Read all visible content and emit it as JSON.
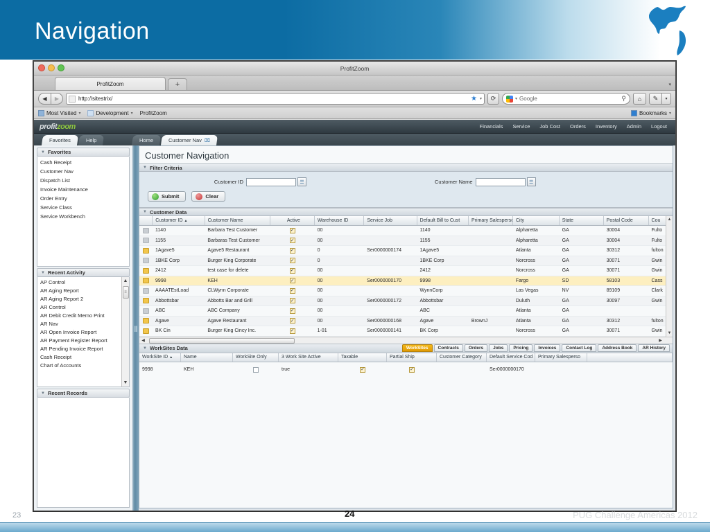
{
  "slide": {
    "title": "Navigation",
    "page_left": "23",
    "page_center": "24",
    "footer_right": "PUG Challenge Americas 2012"
  },
  "browser": {
    "window_title": "ProfitZoom",
    "tab_label": "ProfitZoom",
    "new_tab": "+",
    "back_icon": "◀",
    "forward_icon": "▶",
    "reload_icon": "⟳",
    "url": "http://sitestrix/",
    "star_icon": "★",
    "caret_icon": "▾",
    "search_placeholder": "Google",
    "search_icon": "Ⓔ",
    "home_icon": "⌂",
    "tool_icon": "✎",
    "bookmarks": [
      {
        "label": "Most Visited",
        "caret": "▾"
      },
      {
        "label": "Development",
        "caret": "▾"
      },
      {
        "label": "ProfitZoom",
        "caret": ""
      }
    ],
    "bookmarks_menu": "Bookmarks",
    "bookmarks_menu_caret": "▾"
  },
  "app": {
    "logo_part1": "profit",
    "logo_part2": "zoom",
    "nav": [
      "Financials",
      "Service",
      "Job Cost",
      "Orders",
      "Inventory",
      "Admin",
      "Logout"
    ],
    "left_tabs": [
      {
        "label": "Favorites",
        "active": true
      },
      {
        "label": "Help",
        "active": false
      }
    ],
    "main_tabs": [
      {
        "label": "Home",
        "active": false,
        "close": ""
      },
      {
        "label": "Customer Nav",
        "active": true,
        "close": "⌧"
      }
    ]
  },
  "sidebar": {
    "favorites": {
      "title": "Favorites",
      "triangle": "▼",
      "items": [
        "Cash Receipt",
        "Customer Nav",
        "Dispatch List",
        "Invoice Maintenance",
        "Order Entry",
        "Service Class",
        "Service Workbench"
      ]
    },
    "recent_activity": {
      "title": "Recent Activity",
      "triangle": "▼",
      "up_arrow": "▲",
      "down_arrow": "▼",
      "items": [
        "AP Control",
        "AR Aging Report",
        "AR Aging Report 2",
        "AR Control",
        "AR Debit Credit Memo Print",
        "AR Nav",
        "AR Open Invoice Report",
        "AR Payment Register Report",
        "AR Pending Invoice Report",
        "Cash Receipt",
        "Chart of Accounts"
      ]
    },
    "recent_records": {
      "title": "Recent Records",
      "triangle": "▼"
    }
  },
  "page": {
    "title": "Customer Navigation",
    "filter": {
      "title": "Filter Criteria",
      "triangle": "▼",
      "customer_id_label": "Customer ID",
      "customer_id_value": "",
      "customer_name_label": "Customer Name",
      "customer_name_value": "",
      "lookup_icon": "☰",
      "submit_label": "Submit",
      "clear_label": "Clear"
    },
    "customer_data": {
      "title": "Customer Data",
      "triangle": "▼",
      "sort_icon": "▲",
      "columns": [
        "Customer ID",
        "Customer Name",
        "Active",
        "Warehouse ID",
        "Service Job",
        "Default Bill to Cust",
        "Primary Salesperson",
        "City",
        "State",
        "Postal Code",
        "Cou"
      ],
      "rows": [
        {
          "icon": "grey",
          "id": "1140",
          "name": "Barbara Test Customer",
          "active": true,
          "warehouse": "00",
          "service_job": "",
          "default_bill": "1140",
          "salesperson": "",
          "city": "Alpharetta",
          "state": "GA",
          "postal": "30004",
          "county": "Fulto"
        },
        {
          "icon": "grey",
          "id": "1155",
          "name": "Barbaras Test Customer",
          "active": true,
          "warehouse": "00",
          "service_job": "",
          "default_bill": "1155",
          "salesperson": "",
          "city": "Alpharetta",
          "state": "GA",
          "postal": "30004",
          "county": "Fulto"
        },
        {
          "icon": "yellow",
          "id": "1Agave5",
          "name": "Agave5 Restaurant",
          "active": true,
          "warehouse": "0",
          "service_job": "Ser0000000174",
          "default_bill": "1Agave5",
          "salesperson": "",
          "city": "Atlanta",
          "state": "GA",
          "postal": "30312",
          "county": "fulton"
        },
        {
          "icon": "grey",
          "id": "1BKE Corp",
          "name": "Burger King Corporate",
          "active": true,
          "warehouse": "0",
          "service_job": "",
          "default_bill": "1BKE Corp",
          "salesperson": "",
          "city": "Norcross",
          "state": "GA",
          "postal": "30071",
          "county": "Gwin"
        },
        {
          "icon": "yellow",
          "id": "2412",
          "name": "test case for delete",
          "active": true,
          "warehouse": "00",
          "service_job": "",
          "default_bill": "2412",
          "salesperson": "",
          "city": "Norcross",
          "state": "GA",
          "postal": "30071",
          "county": "Gwin"
        },
        {
          "icon": "yellow",
          "id": "9998",
          "name": "KEH",
          "active": true,
          "warehouse": "00",
          "service_job": "Ser0000000170",
          "default_bill": "9998",
          "salesperson": "",
          "city": "Fargo",
          "state": "SD",
          "postal": "58103",
          "county": "Cass"
        },
        {
          "icon": "grey",
          "id": "AAAATEstLoad",
          "name": "CLWynn Corporate",
          "active": true,
          "warehouse": "00",
          "service_job": "",
          "default_bill": "WynnCorp",
          "salesperson": "",
          "city": "Las Vegas",
          "state": "NV",
          "postal": "89109",
          "county": "Clark"
        },
        {
          "icon": "yellow",
          "id": "Abbottsbar",
          "name": "Abbotts Bar and Grill",
          "active": true,
          "warehouse": "00",
          "service_job": "Ser0000000172",
          "default_bill": "Abbottsbar",
          "salesperson": "",
          "city": "Duluth",
          "state": "GA",
          "postal": "30097",
          "county": "Gwin"
        },
        {
          "icon": "grey",
          "id": "ABC",
          "name": "ABC Company",
          "active": true,
          "warehouse": "00",
          "service_job": "",
          "default_bill": "ABC",
          "salesperson": "",
          "city": "Atlanta",
          "state": "GA",
          "postal": "",
          "county": ""
        },
        {
          "icon": "yellow",
          "id": "Agave",
          "name": "Agave Restaurant",
          "active": true,
          "warehouse": "00",
          "service_job": "Ser0000000168",
          "default_bill": "Agave",
          "salesperson": "BrownJ",
          "city": "Atlanta",
          "state": "GA",
          "postal": "30312",
          "county": "fulton"
        },
        {
          "icon": "yellow",
          "id": "BK Cin",
          "name": "Burger King Cincy Inc.",
          "active": true,
          "warehouse": "1-01",
          "service_job": "Ser0000000141",
          "default_bill": "BK Corp",
          "salesperson": "",
          "city": "Norcross",
          "state": "GA",
          "postal": "30071",
          "county": "Gwin"
        }
      ]
    },
    "worksites": {
      "title": "WorkSites Data",
      "triangle": "▼",
      "tabs": [
        {
          "label": "WorkSites",
          "active": true
        },
        {
          "label": "Contracts",
          "active": false
        },
        {
          "label": "Orders",
          "active": false
        },
        {
          "label": "Jobs",
          "active": false
        },
        {
          "label": "Pricing",
          "active": false
        },
        {
          "label": "Invoices",
          "active": false
        },
        {
          "label": "Contact Log",
          "active": false
        },
        {
          "label": "Address Book",
          "active": false
        },
        {
          "label": "AR History",
          "active": false
        }
      ],
      "sort_icon": "▲",
      "columns": [
        "WorkSite ID",
        "Name",
        "WorkSite Only",
        "3 Work Site Active",
        "Taxable",
        "Partial Ship",
        "Customer Category",
        "Default Service Cod",
        "Primary Salesperso"
      ],
      "rows": [
        {
          "id": "9998",
          "name": "KEH",
          "worksite_only": false,
          "work_site_active": "true",
          "taxable": true,
          "partial_ship": true,
          "customer_category": "",
          "default_service_code": "Ser0000000170",
          "primary_salesperson": ""
        }
      ]
    }
  },
  "colors": {
    "header_blue": "#0c6ca3",
    "accent_orange": "#f5b919",
    "row_select": "#fdefc0",
    "app_dark": "#3a454c"
  }
}
